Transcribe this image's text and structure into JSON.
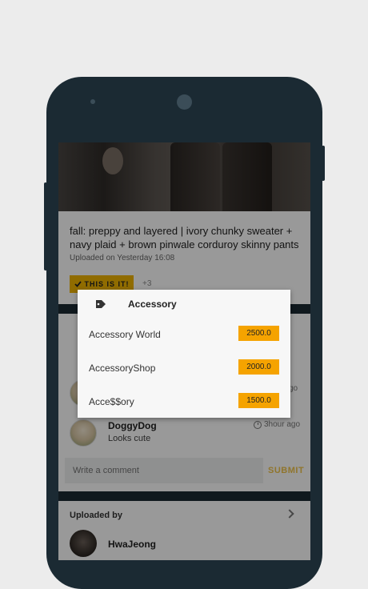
{
  "post": {
    "title": "fall: preppy and layered | ivory chunky sweater + navy plaid + brown pinwale corduroy skinny pants",
    "meta": "Uploaded on Yesterday 16:08",
    "this_is_it_label": "THIS IS IT!",
    "plus_count": "+3"
  },
  "comments": [
    {
      "name": "",
      "text": "",
      "time": "go"
    },
    {
      "name": "DoggyDog",
      "text": "Looks cute",
      "time": "3hour ago"
    }
  ],
  "comment_box": {
    "placeholder": "Write a comment",
    "submit_label": "SUBMIT"
  },
  "uploaded_by": {
    "label": "Uploaded by",
    "name": "HwaJeong"
  },
  "dialog": {
    "title": "Accessory",
    "icon": "tag-icon",
    "shops": [
      {
        "name": "Accessory World",
        "price": "2500.0"
      },
      {
        "name": "AccessoryShop",
        "price": "2000.0"
      },
      {
        "name": "Acce$$ory",
        "price": "1500.0"
      }
    ]
  },
  "colors": {
    "phone_body": "#1b2a33",
    "accent_yellow": "#f0b400",
    "price_orange": "#f5a300"
  }
}
